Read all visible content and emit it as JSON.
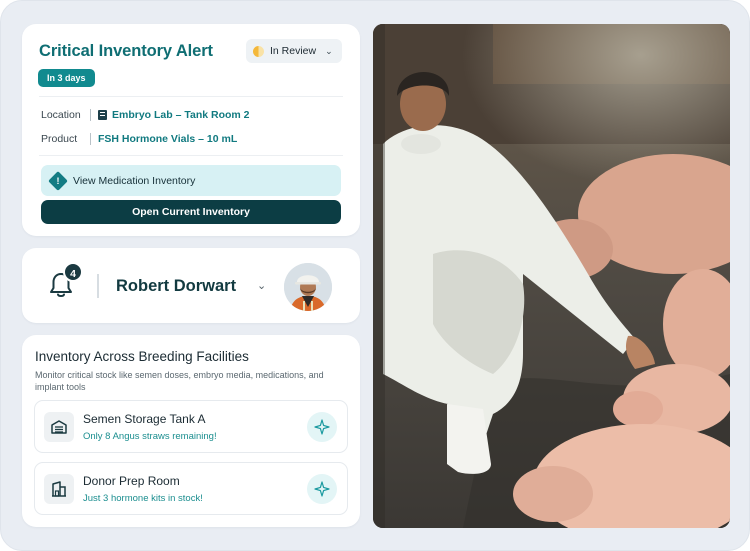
{
  "alert": {
    "title": "Critical Inventory Alert",
    "status": "In Review",
    "due": "In 3 days",
    "location_label": "Location",
    "location_value": "Embryo Lab – Tank Room 2",
    "product_label": "Product",
    "product_value": "FSH Hormone Vials – 10 mL",
    "view_button": "View Medication Inventory",
    "open_button": "Open Current Inventory"
  },
  "user": {
    "notification_count": "4",
    "name": "Robert Dorwart"
  },
  "facilities": {
    "title": "Inventory Across Breeding Facilities",
    "subtitle": "Monitor critical stock like semen doses, embryo media, medications, and implant tools",
    "items": [
      {
        "name": "Semen Storage Tank A",
        "status": "Only 8 Angus straws remaining!",
        "icon": "storage-tank-icon"
      },
      {
        "name": "Donor Prep Room",
        "status": "Just 3 hormone kits in stock!",
        "icon": "building-icon"
      }
    ]
  },
  "colors": {
    "accent": "#0f6e73",
    "badge": "#118a8f",
    "dark_button": "#0c3d44",
    "light_button": "#d7f1f4",
    "status_text": "#1b8e8f"
  }
}
